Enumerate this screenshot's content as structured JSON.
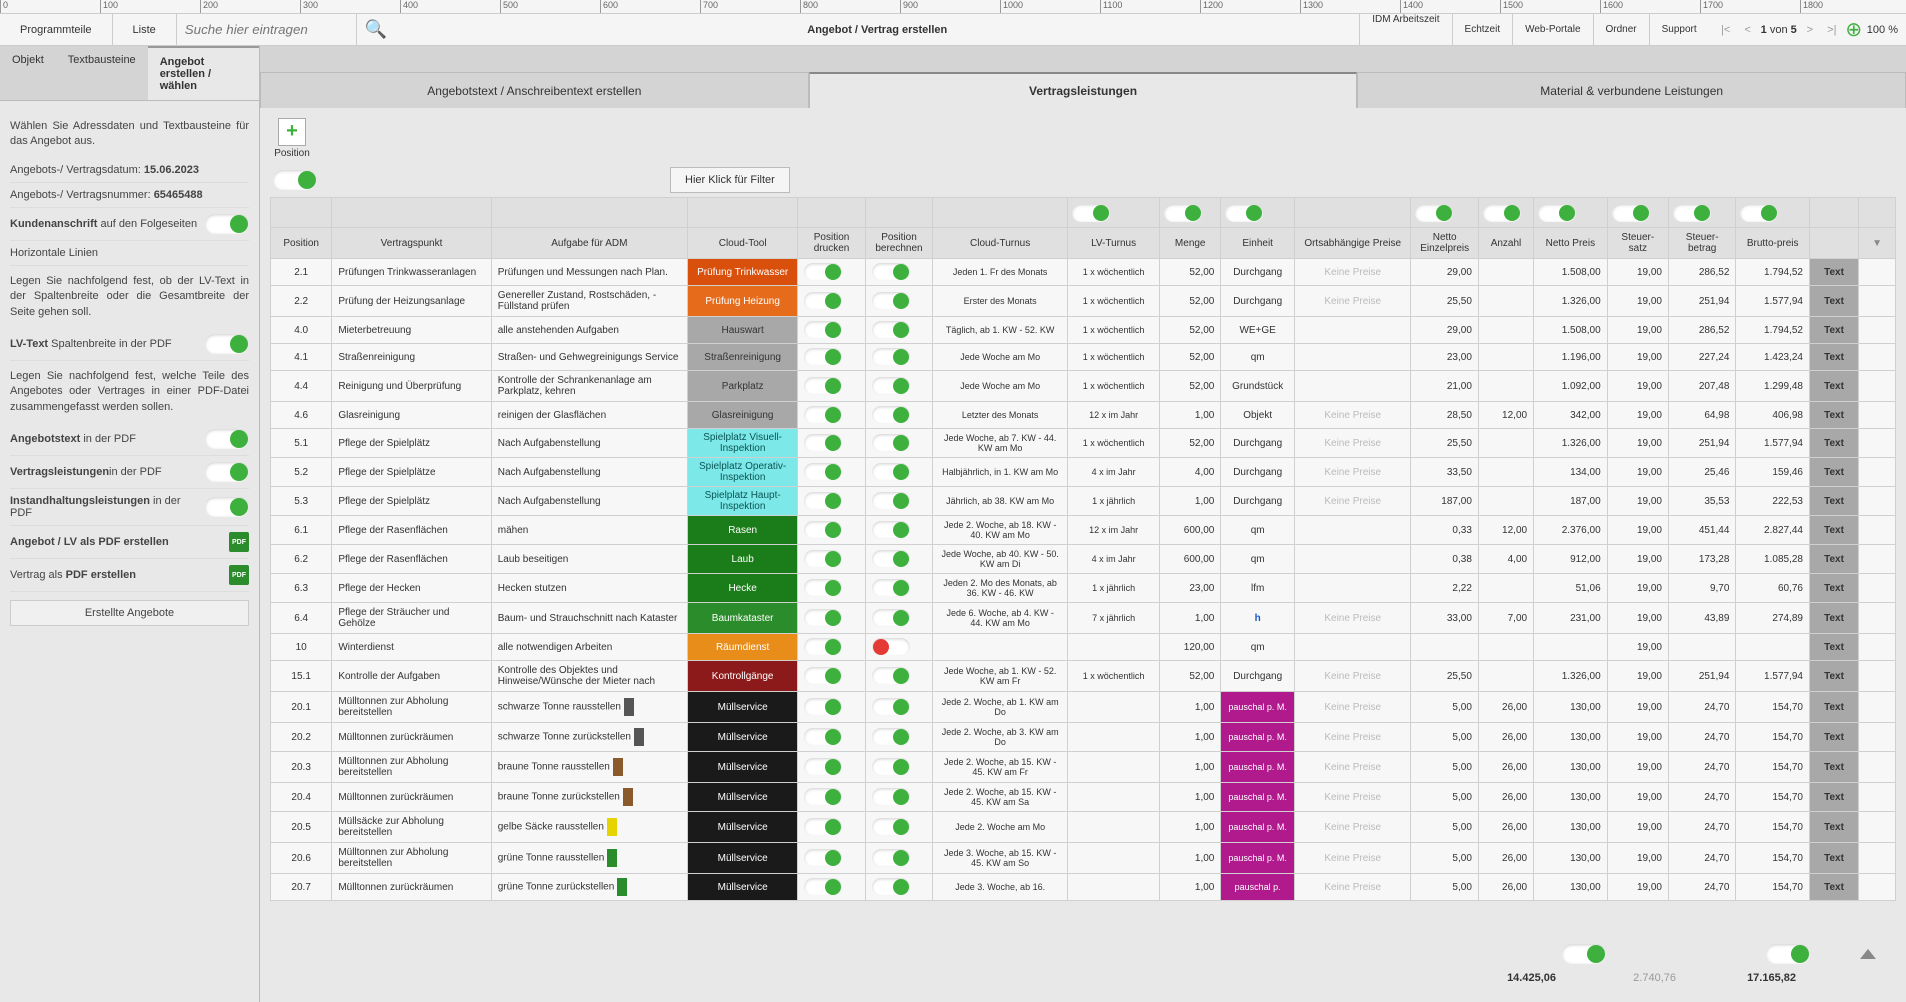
{
  "ruler": [
    0,
    100,
    200,
    300,
    400,
    500,
    600,
    700,
    800,
    900,
    1000,
    1100,
    1200,
    1300,
    1400,
    1500,
    1600,
    1700,
    1800
  ],
  "toolbar": {
    "programmteile": "Programmteile",
    "liste": "Liste",
    "search_placeholder": "Suche hier eintragen",
    "title": "Angebot / Vertrag erstellen",
    "idm": "IDM Arbeitszeit",
    "echtzeit": "Echtzeit",
    "webportale": "Web-Portale",
    "ordner": "Ordner",
    "support": "Support",
    "page_current": "1",
    "page_sep": "von",
    "page_total": "5",
    "zoom": "100 %"
  },
  "side_tabs": {
    "objekt": "Objekt",
    "textbausteine": "Textbausteine",
    "angebot": "Angebot erstellen / wählen"
  },
  "sidebar": {
    "intro": "Wählen Sie Adressdaten und Textbausteine für das Angebot aus.",
    "datum_label": "Angebots-/ Vertragsdatum:",
    "datum": "15.06.2023",
    "nummer_label": "Angebots-/ Vertragsnummer:",
    "nummer": "65465488",
    "kunden_label1": "Kundenanschrift",
    "kunden_label2": "auf den Folgeseiten",
    "horiz": "Horizontale Linien",
    "info1": "Legen Sie nachfolgend fest, ob der LV-Text in der Spaltenbreite oder die Gesamtbreite der Seite gehen soll.",
    "lvtext_b": "LV-Text",
    "lvtext": "Spaltenbreite in der PDF",
    "info2": "Legen Sie nachfolgend fest, welche Teile des Angebotes oder Vertrages in einer PDF-Datei zusammengefasst werden sollen.",
    "angtext_b": "Angebotstext",
    "angtext": "in der PDF",
    "vertleist_b": "Vertragsleistungen",
    "vertleist": "in der PDF",
    "instand_b": "Instandhaltungsleistungen",
    "instand": "in der PDF",
    "pdf1": "Angebot / LV als PDF erstellen",
    "pdf2": "Vertrag als PDF erstellen",
    "erstellte": "Erstellte Angebote"
  },
  "main_tabs": {
    "t1": "Angebotstext / Anschreibentext erstellen",
    "t2": "Vertragsleistungen",
    "t3": "Material & verbundene Leistungen"
  },
  "addpos": {
    "plus": "+",
    "label": "Position"
  },
  "filter": "Hier Klick für Filter",
  "headers": {
    "position": "Position",
    "vertragspunkt": "Vertragspunkt",
    "aufgabe": "Aufgabe für ADM",
    "cloudtool": "Cloud-Tool",
    "pos_drucken": "Position drucken",
    "pos_berechnen": "Position berechnen",
    "cloud_turnus": "Cloud-Turnus",
    "lv_turnus": "LV-Turnus",
    "menge": "Menge",
    "einheit": "Einheit",
    "ortspreise": "Ortsabhängige Preise",
    "netto_ep": "Netto Einzelpreis",
    "anzahl": "Anzahl",
    "netto_preis": "Netto Preis",
    "steuersatz": "Steuer-satz",
    "steuerbetrag": "Steuer-betrag",
    "bruttopreis": "Brutto-preis"
  },
  "textbtn": "Text",
  "noprice": "Keine Preise",
  "rows": [
    {
      "pos": "2.1",
      "vp": "Prüfungen Trinkwasseranlagen",
      "auf": "Prüfungen und Messungen nach Plan.",
      "cloud": "Prüfung Trinkwasser",
      "cloudcls": "dorange",
      "ct": "Jeden 1. Fr des Monats",
      "lv": "1 x wöchentlich",
      "menge": "52,00",
      "einh": "Durchgang",
      "ort": "np",
      "nep": "29,00",
      "anz": "",
      "np": "1.508,00",
      "ss": "19,00",
      "sb": "286,52",
      "bp": "1.794,52"
    },
    {
      "pos": "2.2",
      "vp": "Prüfung der Heizungsanlage",
      "auf": "Genereller Zustand, Rostschäden, - Füllstand prüfen",
      "cloud": "Prüfung Heizung",
      "cloudcls": "orange",
      "ct": "Erster des Monats",
      "lv": "1 x wöchentlich",
      "menge": "52,00",
      "einh": "Durchgang",
      "ort": "np",
      "nep": "25,50",
      "anz": "",
      "np": "1.326,00",
      "ss": "19,00",
      "sb": "251,94",
      "bp": "1.577,94"
    },
    {
      "pos": "4.0",
      "vp": "Mieterbetreuung",
      "auf": "alle anstehenden Aufgaben",
      "cloud": "Hauswart",
      "cloudcls": "gray",
      "ct": "Täglich, ab 1. KW - 52. KW",
      "lv": "1 x wöchentlich",
      "menge": "52,00",
      "einh": "WE+GE",
      "ort": "",
      "nep": "29,00",
      "anz": "",
      "np": "1.508,00",
      "ss": "19,00",
      "sb": "286,52",
      "bp": "1.794,52"
    },
    {
      "pos": "4.1",
      "vp": "Straßenreinigung",
      "auf": "Straßen- und Gehwegreinigungs Service",
      "cloud": "Straßenreinigung",
      "cloudcls": "gray",
      "ct": "Jede Woche am Mo",
      "lv": "1 x wöchentlich",
      "menge": "52,00",
      "einh": "qm",
      "ort": "",
      "nep": "23,00",
      "anz": "",
      "np": "1.196,00",
      "ss": "19,00",
      "sb": "227,24",
      "bp": "1.423,24"
    },
    {
      "pos": "4.4",
      "vp": "Reinigung und Überprüfung",
      "auf": "Kontrolle der Schrankenanlage am Parkplatz, kehren",
      "cloud": "Parkplatz",
      "cloudcls": "gray",
      "ct": "Jede Woche am Mo",
      "lv": "1 x wöchentlich",
      "menge": "52,00",
      "einh": "Grundstück",
      "ort": "",
      "nep": "21,00",
      "anz": "",
      "np": "1.092,00",
      "ss": "19,00",
      "sb": "207,48",
      "bp": "1.299,48"
    },
    {
      "pos": "4.6",
      "vp": "Glasreinigung",
      "auf": "reinigen der Glasflächen",
      "cloud": "Glasreinigung",
      "cloudcls": "gray",
      "ct": "Letzter des Monats",
      "lv": "12 x im Jahr",
      "menge": "1,00",
      "einh": "Objekt",
      "ort": "np",
      "nep": "28,50",
      "anz": "12,00",
      "np": "342,00",
      "ss": "19,00",
      "sb": "64,98",
      "bp": "406,98"
    },
    {
      "pos": "5.1",
      "vp": "Pflege der Spielplätz",
      "auf": "Nach Aufgabenstellung",
      "cloud": "Spielplatz Visuell-Inspektion",
      "cloudcls": "cyan",
      "ct": "Jede Woche, ab 7. KW - 44. KW am Mo",
      "lv": "1 x wöchentlich",
      "menge": "52,00",
      "einh": "Durchgang",
      "ort": "np",
      "nep": "25,50",
      "anz": "",
      "np": "1.326,00",
      "ss": "19,00",
      "sb": "251,94",
      "bp": "1.577,94"
    },
    {
      "pos": "5.2",
      "vp": "Pflege der Spielplätze",
      "auf": "Nach Aufgabenstellung",
      "cloud": "Spielplatz Operativ-Inspektion",
      "cloudcls": "cyan",
      "ct": "Halbjährlich, in 1. KW am Mo",
      "lv": "4 x im Jahr",
      "menge": "4,00",
      "einh": "Durchgang",
      "ort": "np",
      "nep": "33,50",
      "anz": "",
      "np": "134,00",
      "ss": "19,00",
      "sb": "25,46",
      "bp": "159,46"
    },
    {
      "pos": "5.3",
      "vp": "Pflege der Spielplätz",
      "auf": "Nach Aufgabenstellung",
      "cloud": "Spielplatz Haupt-Inspektion",
      "cloudcls": "cyan",
      "ct": "Jährlich, ab 38. KW am Mo",
      "lv": "1 x jährlich",
      "menge": "1,00",
      "einh": "Durchgang",
      "ort": "np",
      "nep": "187,00",
      "anz": "",
      "np": "187,00",
      "ss": "19,00",
      "sb": "35,53",
      "bp": "222,53"
    },
    {
      "pos": "6.1",
      "vp": "Pflege der Rasenflächen",
      "auf": "mähen",
      "cloud": "Rasen",
      "cloudcls": "green",
      "ct": "Jede 2. Woche, ab 18. KW - 40. KW am Mo",
      "lv": "12 x im Jahr",
      "menge": "600,00",
      "einh": "qm",
      "ort": "",
      "nep": "0,33",
      "anz": "12,00",
      "np": "2.376,00",
      "ss": "19,00",
      "sb": "451,44",
      "bp": "2.827,44"
    },
    {
      "pos": "6.2",
      "vp": "Pflege der Rasenflächen",
      "auf": "Laub beseitigen",
      "cloud": "Laub",
      "cloudcls": "green",
      "ct": "Jede Woche, ab 40. KW - 50. KW am Di",
      "lv": "4 x im Jahr",
      "menge": "600,00",
      "einh": "qm",
      "ort": "",
      "nep": "0,38",
      "anz": "4,00",
      "np": "912,00",
      "ss": "19,00",
      "sb": "173,28",
      "bp": "1.085,28"
    },
    {
      "pos": "6.3",
      "vp": "Pflege der Hecken",
      "auf": "Hecken stutzen",
      "cloud": "Hecke",
      "cloudcls": "green",
      "ct": "Jeden 2. Mo des Monats, ab 36. KW - 46. KW",
      "lv": "1 x jährlich",
      "menge": "23,00",
      "einh": "lfm",
      "ort": "",
      "nep": "2,22",
      "anz": "",
      "np": "51,06",
      "ss": "19,00",
      "sb": "9,70",
      "bp": "60,76"
    },
    {
      "pos": "6.4",
      "vp": "Pflege der Sträucher und Gehölze",
      "auf": "Baum- und Strauchschnitt nach Kataster",
      "cloud": "Baumkataster",
      "cloudcls": "green2",
      "ct": "Jede 6. Woche, ab 4. KW - 44. KW am Mo",
      "lv": "7 x jährlich",
      "menge": "1,00",
      "einh": "h",
      "einhcls": "einheit-h",
      "ort": "np",
      "nep": "33,00",
      "anz": "7,00",
      "np": "231,00",
      "ss": "19,00",
      "sb": "43,89",
      "bp": "274,89"
    },
    {
      "pos": "10",
      "vp": "Winterdienst",
      "auf": "alle notwendigen Arbeiten",
      "cloud": "Räumdienst",
      "cloudcls": "orange2",
      "drOff": true,
      "ct": "",
      "lv": "",
      "menge": "120,00",
      "einh": "qm",
      "ort": "",
      "nep": "",
      "anz": "",
      "np": "",
      "ss": "19,00",
      "sb": "",
      "bp": ""
    },
    {
      "pos": "15.1",
      "vp": "Kontrolle der Aufgaben",
      "auf": "Kontrolle des Objektes und Hinweise/Wünsche der Mieter nach",
      "cloud": "Kontrollgänge",
      "cloudcls": "darkred",
      "ct": "Jede Woche, ab 1. KW - 52. KW am Fr",
      "lv": "1 x wöchentlich",
      "menge": "52,00",
      "einh": "Durchgang",
      "ort": "np",
      "nep": "25,50",
      "anz": "",
      "np": "1.326,00",
      "ss": "19,00",
      "sb": "251,94",
      "bp": "1.577,94"
    },
    {
      "pos": "20.1",
      "vp": "Mülltonnen zur Abholung bereitstellen",
      "auf": "schwarze Tonne rausstellen",
      "swatch": "#555",
      "cloud": "Müllservice",
      "cloudcls": "black",
      "ct": "Jede 2. Woche, ab 1. KW am Do",
      "lv": "",
      "menge": "1,00",
      "einh": "pauschal p. M.",
      "einhcls": "einheit-pink",
      "ort": "np",
      "nep": "5,00",
      "anz": "26,00",
      "np": "130,00",
      "ss": "19,00",
      "sb": "24,70",
      "bp": "154,70"
    },
    {
      "pos": "20.2",
      "vp": "Mülltonnen zurückräumen",
      "auf": "schwarze Tonne zurückstellen",
      "swatch": "#555",
      "cloud": "Müllservice",
      "cloudcls": "black",
      "ct": "Jede 2. Woche, ab 3. KW am Do",
      "lv": "",
      "menge": "1,00",
      "einh": "pauschal p. M.",
      "einhcls": "einheit-pink",
      "ort": "np",
      "nep": "5,00",
      "anz": "26,00",
      "np": "130,00",
      "ss": "19,00",
      "sb": "24,70",
      "bp": "154,70"
    },
    {
      "pos": "20.3",
      "vp": "Mülltonnen zur Abholung bereitstellen",
      "auf": "braune Tonne rausstellen",
      "swatch": "#8b5a2b",
      "cloud": "Müllservice",
      "cloudcls": "black",
      "ct": "Jede 2. Woche, ab 15. KW - 45. KW am Fr",
      "lv": "",
      "menge": "1,00",
      "einh": "pauschal p. M.",
      "einhcls": "einheit-pink",
      "ort": "np",
      "nep": "5,00",
      "anz": "26,00",
      "np": "130,00",
      "ss": "19,00",
      "sb": "24,70",
      "bp": "154,70"
    },
    {
      "pos": "20.4",
      "vp": "Mülltonnen zurückräumen",
      "auf": "braune Tonne zurückstellen",
      "swatch": "#8b5a2b",
      "cloud": "Müllservice",
      "cloudcls": "black",
      "ct": "Jede 2. Woche, ab 15. KW - 45. KW am Sa",
      "lv": "",
      "menge": "1,00",
      "einh": "pauschal p. M.",
      "einhcls": "einheit-pink",
      "ort": "np",
      "nep": "5,00",
      "anz": "26,00",
      "np": "130,00",
      "ss": "19,00",
      "sb": "24,70",
      "bp": "154,70"
    },
    {
      "pos": "20.5",
      "vp": "Müllsäcke zur Abholung bereitstellen",
      "auf": "gelbe Säcke rausstellen",
      "swatch": "#e6d400",
      "cloud": "Müllservice",
      "cloudcls": "black",
      "ct": "Jede 2. Woche am Mo",
      "lv": "",
      "menge": "1,00",
      "einh": "pauschal p. M.",
      "einhcls": "einheit-pink",
      "ort": "np",
      "nep": "5,00",
      "anz": "26,00",
      "np": "130,00",
      "ss": "19,00",
      "sb": "24,70",
      "bp": "154,70"
    },
    {
      "pos": "20.6",
      "vp": "Mülltonnen zur Abholung bereitstellen",
      "auf": "grüne Tonne rausstellen",
      "swatch": "#2a8c2a",
      "cloud": "Müllservice",
      "cloudcls": "black",
      "ct": "Jede 3. Woche, ab 15. KW - 45. KW am So",
      "lv": "",
      "menge": "1,00",
      "einh": "pauschal p. M.",
      "einhcls": "einheit-pink",
      "ort": "np",
      "nep": "5,00",
      "anz": "26,00",
      "np": "130,00",
      "ss": "19,00",
      "sb": "24,70",
      "bp": "154,70"
    },
    {
      "pos": "20.7",
      "vp": "Mülltonnen zurückräumen",
      "auf": "grüne Tonne zurückstellen",
      "swatch": "#2a8c2a",
      "cloud": "Müllservice",
      "cloudcls": "black",
      "ct": "Jede 3. Woche, ab 16.",
      "lv": "",
      "menge": "1,00",
      "einh": "pauschal p.",
      "einhcls": "einheit-pink",
      "ort": "np",
      "nep": "5,00",
      "anz": "26,00",
      "np": "130,00",
      "ss": "19,00",
      "sb": "24,70",
      "bp": "154,70"
    }
  ],
  "footer": {
    "sum_netto": "14.425,06",
    "sum_steuer": "2.740,76",
    "sum_brutto": "17.165,82"
  }
}
